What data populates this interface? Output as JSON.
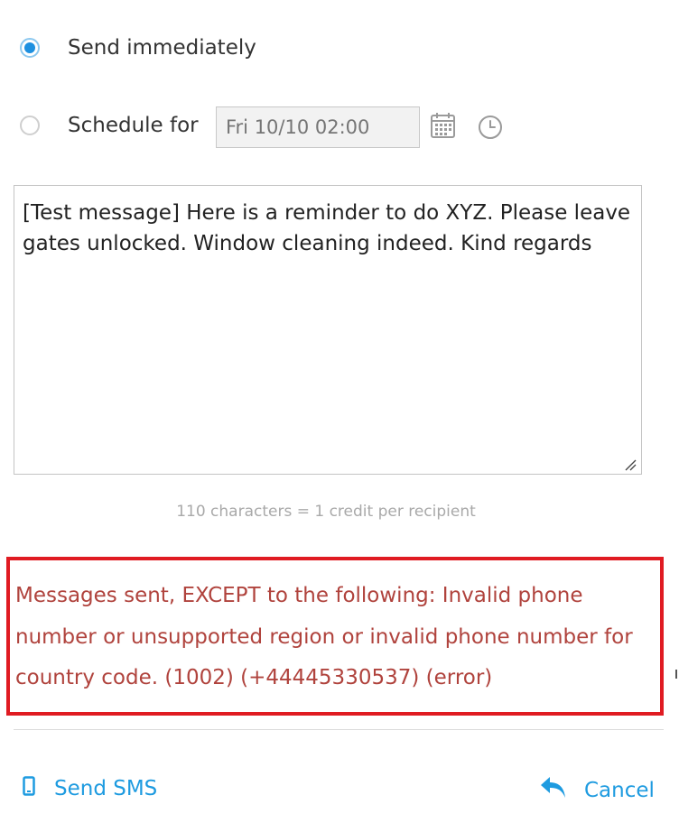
{
  "send_options": {
    "immediate_label": "Send immediately",
    "immediate_selected": true,
    "schedule_label": "Schedule for",
    "schedule_selected": false,
    "schedule_datetime_placeholder": "Fri 10/10 02:00"
  },
  "icons": {
    "calendar": "calendar-icon",
    "clock": "clock-icon",
    "phone": "phone-icon",
    "reply": "reply-icon"
  },
  "message": {
    "text": "[Test message] Here is a reminder to do XYZ. Please leave gates unlocked. Window cleaning indeed. Kind regards"
  },
  "char_count_text": "110 characters = 1 credit per recipient",
  "error": {
    "text": "Messages sent, EXCEPT to the following: Invalid phone number or unsupported region or invalid phone number for country code. (1002) (+44445330537) (error)"
  },
  "footer": {
    "send_label": "Send SMS",
    "cancel_label": "Cancel"
  },
  "colors": {
    "accent": "#1e9be0",
    "radio_selected": "#1e90e0",
    "error_border": "#e01b22",
    "error_text": "#b0433d"
  }
}
